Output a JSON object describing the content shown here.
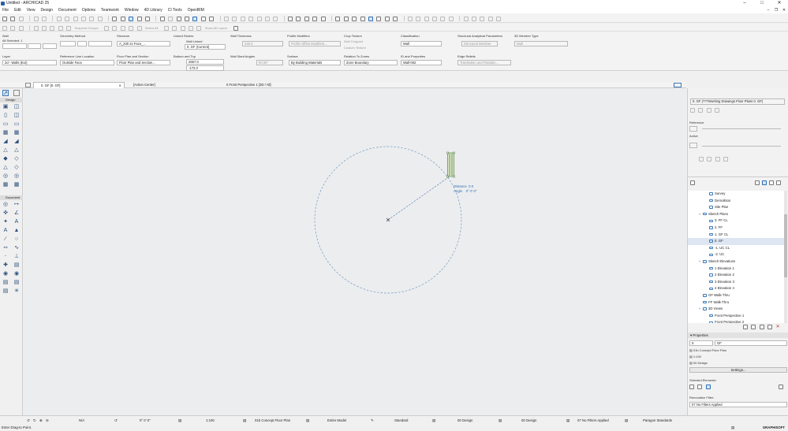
{
  "window": {
    "title": "Untitled - ARCHICAD 25"
  },
  "menu": [
    "File",
    "Edit",
    "View",
    "Design",
    "Document",
    "Options",
    "Teamwork",
    "Window",
    "4D Library",
    "CI Tools",
    "OpenBIM"
  ],
  "infobox": {
    "wall_label": "Wall",
    "all_selected": "All Selected: 1",
    "geometry_method": "Geometry Method",
    "structure_label": "Structure",
    "structure_value": "A_230 2x Face_...",
    "linked_stories_label": "Linked Stories",
    "wall_linked": "Wall Linked",
    "home_story": "0. GF (Current)",
    "wall_thickness_label": "Wall Thickness",
    "wall_thickness": "230.0",
    "profile_modifiers_label": "Profile Modifiers",
    "profile_modifiers_value": "Profile Offset Modifiers...",
    "crop_texture_label": "Crop Texture",
    "wall_cropped": "Wall Cropped",
    "custom_texture": "Custom Texture",
    "classification_label": "Classification",
    "classification_value": "Wall",
    "structural_label": "Structural Analytical Parameters",
    "structural_value": "Structural Member",
    "member_type_label": "3D Member Type",
    "member_type_value": "Wall",
    "layer_label": "Layer",
    "layer_value": "2d - Walls (Ext)",
    "ref_line_label": "Reference Line Location",
    "ref_line_value": "Outside Face",
    "floorplan_label": "Floor Plan and Section",
    "floorplan_value": "Floor Plan and Section...",
    "bottom_top_label": "Bottom and Top",
    "top_value": "2657.0",
    "bottom_value": "-172.0",
    "slant_label": "Wall Slant Angles",
    "slant_value": "90.00°",
    "surface_label": "Surface",
    "surface_value": "By Building Materials",
    "zone_label": "Relation To Zones",
    "zone_value": "Zone Boundary",
    "id_label": "ID and Properties",
    "id_value": "Wall-002",
    "edge_label": "Edge Reliefs",
    "edge_value": "Translation and Rotation..."
  },
  "toolbar": {
    "suspend_groups": "Suspend Groups",
    "select_all": "Select All",
    "show_all_layers": "Show All Layers"
  },
  "tabs": [
    {
      "label": "0. GF [0. GF]"
    },
    {
      "label": "[Action Center]"
    },
    {
      "label": "0 Front Perspective 1 [3D / All]"
    }
  ],
  "toolbox": {
    "design_header": "Design",
    "document_header": "Document"
  },
  "canvas": {
    "tracker_distance_label": "Distance",
    "tracker_distance_value": "0.0",
    "tracker_angle_label": "Angle",
    "tracker_angle_value": "0° 0' 0\""
  },
  "navigator": {
    "viewpoint": "0. GF (???Working Drawings Floor Plans 0. GF)",
    "reference_label": "Reference",
    "active_label": "Active",
    "tree": [
      {
        "label": "Survey",
        "indent": 2,
        "toggle": ""
      },
      {
        "label": "Demolition",
        "indent": 2,
        "toggle": ""
      },
      {
        "label": "Site Plan",
        "indent": 2,
        "toggle": ""
      },
      {
        "label": "Sketch Plans",
        "indent": 1,
        "toggle": "v"
      },
      {
        "label": "3. FF CL",
        "indent": 2,
        "toggle": ""
      },
      {
        "label": "2. FF",
        "indent": 2,
        "toggle": ""
      },
      {
        "label": "1. GF CL",
        "indent": 2,
        "toggle": ""
      },
      {
        "label": "0. GF",
        "indent": 2,
        "toggle": "",
        "selected": true
      },
      {
        "label": "-1. UC CL",
        "indent": 2,
        "toggle": ""
      },
      {
        "label": "-2. UC",
        "indent": 2,
        "toggle": ""
      },
      {
        "label": "Sketch Elevations",
        "indent": 1,
        "toggle": "v"
      },
      {
        "label": "1 Elevation 1",
        "indent": 2,
        "toggle": ""
      },
      {
        "label": "2 Elevation 2",
        "indent": 2,
        "toggle": ""
      },
      {
        "label": "3 Elevation 3",
        "indent": 2,
        "toggle": ""
      },
      {
        "label": "4 Elevation 4",
        "indent": 2,
        "toggle": ""
      },
      {
        "label": "GF Walk-Thru",
        "indent": 1,
        "toggle": ""
      },
      {
        "label": "FF Walk-Thru",
        "indent": 1,
        "toggle": ""
      },
      {
        "label": "3D Views",
        "indent": 1,
        "toggle": "v"
      },
      {
        "label": "Front Perspective 1",
        "indent": 2,
        "toggle": ""
      },
      {
        "label": "Front Perspective 2",
        "indent": 2,
        "toggle": ""
      }
    ],
    "properties_header": "Properties",
    "prop_id": "0.",
    "prop_name": "GF",
    "prop_plan": "01b Concept Floor Plan",
    "prop_scale": "1:100",
    "prop_layer": "00 Design",
    "settings_button": "Settings...",
    "selected_elements_label": "Selected Elements:",
    "renovation_label": "Renovation Filter:",
    "renovation_value": "07 No Filters Applied"
  },
  "status": {
    "zoom": "N/A",
    "angle": "0° 0' 0\"",
    "scale": "1:100",
    "view": "01b Concept Floor Plan",
    "model": "Entire Model",
    "pen": "Standard",
    "layer": "00 Design",
    "renovation": "07 No Filters Applied",
    "dimension": "Paragon Standards",
    "prompt": "Enter Drag-to Point.",
    "brand": "GRAPHISOFT"
  }
}
